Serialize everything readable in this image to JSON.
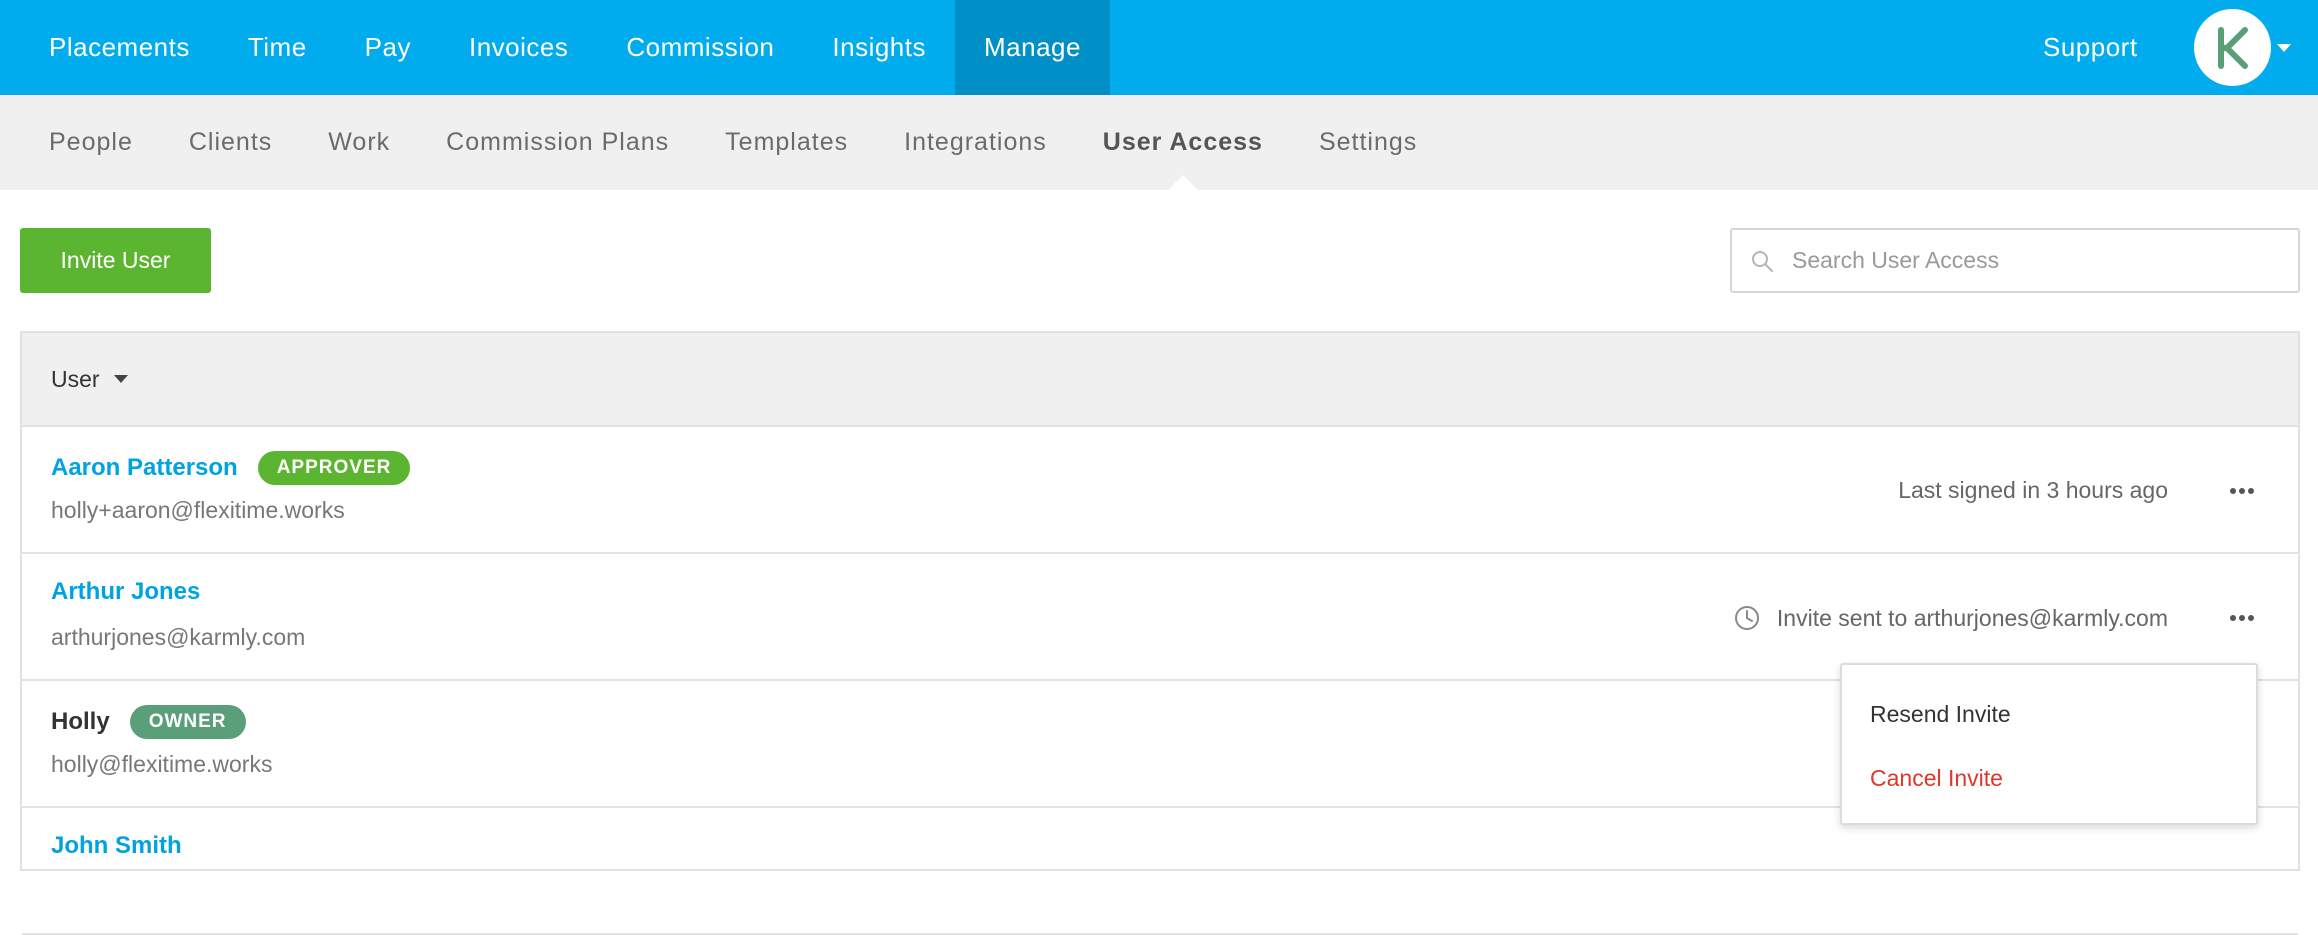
{
  "topnav": {
    "items": [
      {
        "label": "Placements"
      },
      {
        "label": "Time"
      },
      {
        "label": "Pay"
      },
      {
        "label": "Invoices"
      },
      {
        "label": "Commission"
      },
      {
        "label": "Insights"
      },
      {
        "label": "Manage",
        "active": true
      }
    ],
    "support_label": "Support",
    "bg_color": "#00aced",
    "active_color": "#0090c7"
  },
  "subnav": {
    "items": [
      {
        "label": "People"
      },
      {
        "label": "Clients"
      },
      {
        "label": "Work"
      },
      {
        "label": "Commission Plans"
      },
      {
        "label": "Templates"
      },
      {
        "label": "Integrations"
      },
      {
        "label": "User Access",
        "active": true
      },
      {
        "label": "Settings"
      }
    ]
  },
  "toolbar": {
    "invite_label": "Invite User",
    "search_placeholder": "Search User Access"
  },
  "table": {
    "column_user": "User",
    "rows": [
      {
        "name": "Aaron Patterson",
        "badge": "APPROVER",
        "email": "holly+aaron@flexitime.works",
        "status": "Last signed in 3 hours ago"
      },
      {
        "name": "Arthur Jones",
        "badge": "",
        "email": "arthurjones@karmly.com",
        "status": "Invite sent to arthurjones@karmly.com"
      },
      {
        "name": "Holly",
        "badge": "OWNER",
        "email": "holly@flexitime.works",
        "status": ""
      },
      {
        "name": "John Smith",
        "badge": "",
        "email": "",
        "status": ""
      }
    ]
  },
  "dropdown": {
    "resend_label": "Resend Invite",
    "cancel_label": "Cancel Invite"
  }
}
